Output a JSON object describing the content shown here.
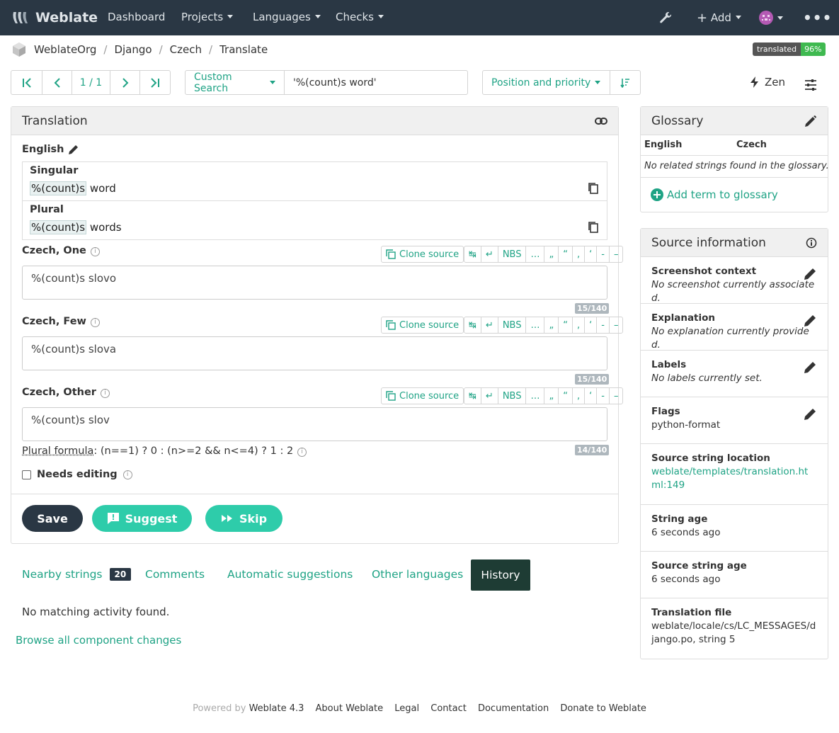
{
  "navbar": {
    "brand": "Weblate",
    "items": [
      "Dashboard",
      "Projects",
      "Languages",
      "Checks"
    ],
    "add": "Add"
  },
  "breadcrumb": [
    "WeblateOrg",
    "Django",
    "Czech",
    "Translate"
  ],
  "badge": {
    "label": "translated",
    "value": "96%"
  },
  "pager": {
    "position": "1 / 1"
  },
  "search": {
    "mode": "Custom Search",
    "query": "'%(count)s word'"
  },
  "sort": {
    "label": "Position and priority"
  },
  "zen": "Zen",
  "translation": {
    "title": "Translation",
    "source_lang": "English",
    "singular_label": "Singular",
    "singular_ph": "%(count)s",
    "singular_rest": " word",
    "plural_label": "Plural",
    "plural_ph": "%(count)s",
    "plural_rest": " words",
    "forms": [
      {
        "label": "Czech, One",
        "value": "%(count)s slovo",
        "counter": "15/140"
      },
      {
        "label": "Czech, Few",
        "value": "%(count)s slova",
        "counter": "15/140"
      },
      {
        "label": "Czech, Other",
        "value": "%(count)s slov",
        "counter": "14/140"
      }
    ],
    "clone": "Clone source",
    "chars": [
      "↹",
      "↵",
      "NBS",
      "…",
      "„",
      "“",
      ",",
      "‘",
      "-",
      "–"
    ],
    "plural_formula_label": "Plural formula",
    "plural_formula": ": (n==1) ? 0 : (n>=2 && n<=4) ? 1 : 2",
    "needs_editing": "Needs editing",
    "save": "Save",
    "suggest": "Suggest",
    "skip": "Skip"
  },
  "tabs": {
    "nearby": "Nearby strings",
    "nearby_count": "20",
    "comments": "Comments",
    "auto": "Automatic suggestions",
    "other": "Other languages",
    "history": "History"
  },
  "history": {
    "empty": "No matching activity found.",
    "browse": "Browse all component changes"
  },
  "glossary": {
    "title": "Glossary",
    "col1": "English",
    "col2": "Czech",
    "empty": "No related strings found in the glossary.",
    "add": "Add term to glossary"
  },
  "source_info": {
    "title": "Source information",
    "rows": [
      {
        "title": "Screenshot context",
        "value": "No screenshot currently associated."
      },
      {
        "title": "Explanation",
        "value": "No explanation currently provided."
      },
      {
        "title": "Labels",
        "value": "No labels currently set."
      },
      {
        "title": "Flags",
        "value": "python-format"
      },
      {
        "title": "Source string location",
        "value": "weblate/templates/translation.html:149"
      },
      {
        "title": "String age",
        "value": "6 seconds ago"
      },
      {
        "title": "Source string age",
        "value": "6 seconds ago"
      },
      {
        "title": "Translation file",
        "value": "weblate/locale/cs/LC_MESSAGES/django.po, string 5"
      }
    ]
  },
  "footer": {
    "powered": "Powered by",
    "version": "Weblate 4.3",
    "links": [
      "About Weblate",
      "Legal",
      "Contact",
      "Documentation",
      "Donate to Weblate"
    ]
  },
  "colors": {
    "accent": "#1fa385",
    "navbar": "#2a3744",
    "dark_button": "#2a3744",
    "history_tab": "#1e3c34"
  }
}
